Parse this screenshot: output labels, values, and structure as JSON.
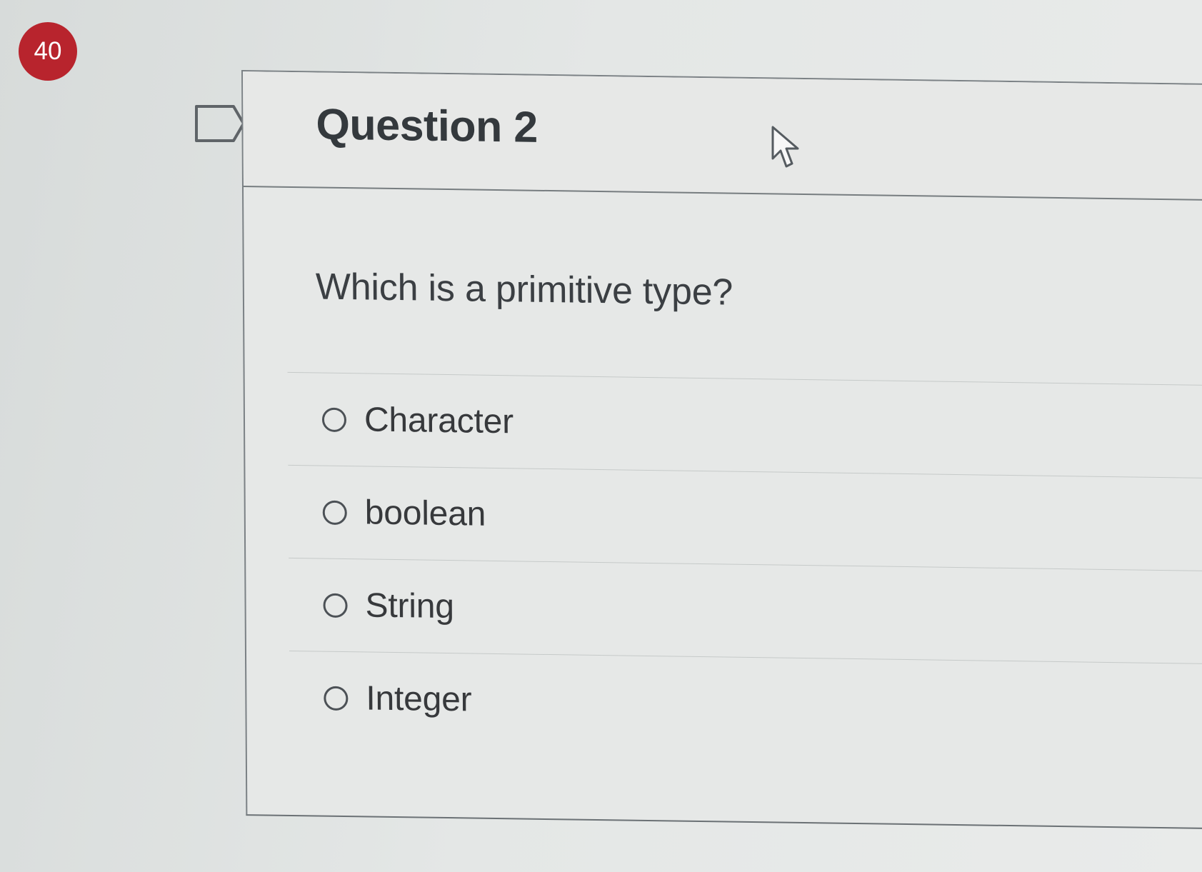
{
  "question_number_badge": "40",
  "question": {
    "title": "Question 2",
    "prompt": "Which is a primitive type?",
    "answers": [
      {
        "label": "Character"
      },
      {
        "label": "boolean"
      },
      {
        "label": "String"
      },
      {
        "label": "Integer"
      }
    ]
  },
  "icons": {
    "flag": "flag-icon",
    "pointer": "mouse-pointer-icon",
    "radio": "radio-button-icon"
  },
  "colors": {
    "badge": "#b8242d",
    "text": "#37393c",
    "border": "#7b8185",
    "background": "#e6e8e7"
  }
}
